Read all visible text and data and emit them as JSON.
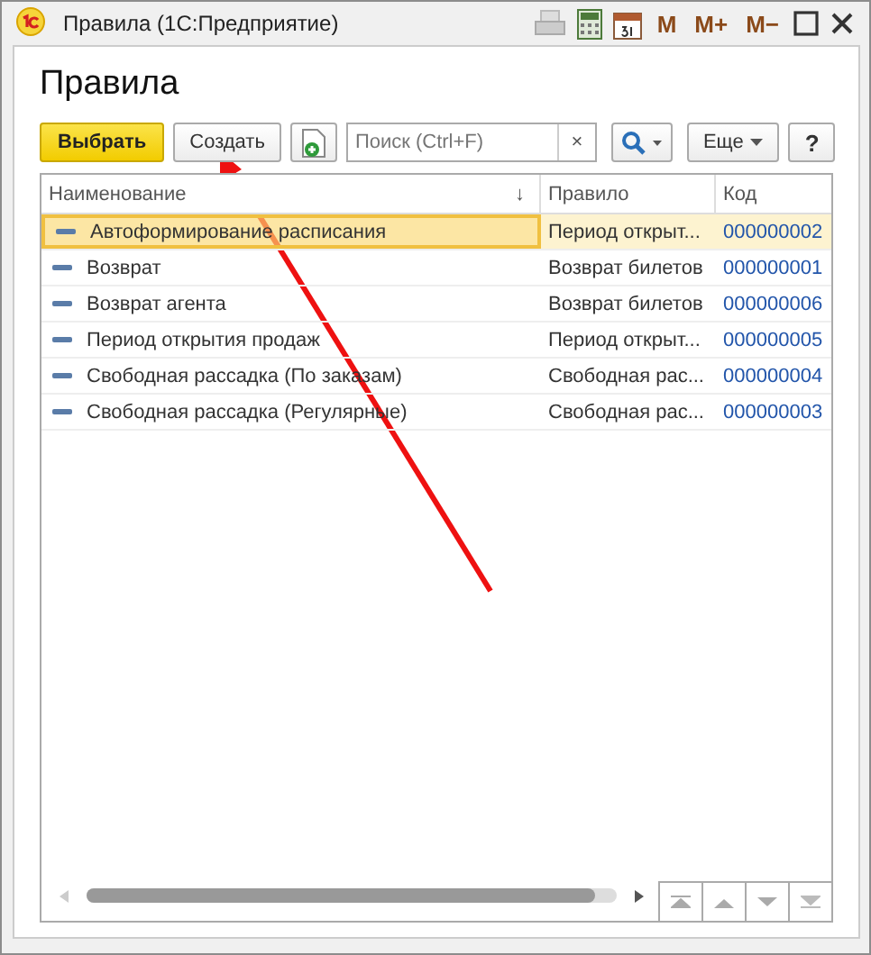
{
  "window": {
    "title": "Правила  (1С:Предприятие)",
    "memory_buttons": [
      "M",
      "M+",
      "M−"
    ]
  },
  "heading": "Правила",
  "toolbar": {
    "select_button": "Выбрать",
    "create_button": "Создать",
    "search": {
      "placeholder": "Поиск (Ctrl+F)",
      "clear": "×"
    },
    "more_button": "Еще",
    "help_button": "?"
  },
  "table": {
    "columns": [
      {
        "label": "Наименование",
        "sort_mark": "↓"
      },
      {
        "label": "Правило"
      },
      {
        "label": "Код"
      }
    ],
    "rows": [
      {
        "name": "Автоформирование расписания",
        "rule": "Период открыт...",
        "code": "000000002",
        "selected": true
      },
      {
        "name": "Возврат",
        "rule": "Возврат билетов",
        "code": "000000001",
        "selected": false
      },
      {
        "name": "Возврат агента",
        "rule": "Возврат билетов",
        "code": "000000006",
        "selected": false
      },
      {
        "name": "Период открытия продаж",
        "rule": "Период открыт...",
        "code": "000000005",
        "selected": false
      },
      {
        "name": "Свободная рассадка (По заказам)",
        "rule": "Свободная рас...",
        "code": "000000004",
        "selected": false
      },
      {
        "name": "Свободная рассадка (Регулярные)",
        "rule": "Свободная рас...",
        "code": "000000003",
        "selected": false
      }
    ]
  }
}
